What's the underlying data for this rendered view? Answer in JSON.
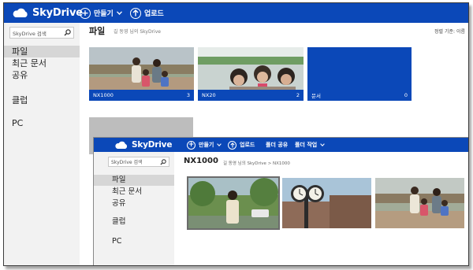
{
  "app": {
    "title": "SkyDrive"
  },
  "toolbar": {
    "create_label": "만들기",
    "upload_label": "업로드"
  },
  "sidebar": {
    "search_placeholder": "SkyDrive 검색",
    "items": [
      {
        "label": "파일",
        "selected": true
      },
      {
        "label": "최근 문서",
        "selected": false
      },
      {
        "label": "공유",
        "selected": false
      },
      {
        "label": "클럽",
        "selected": false
      },
      {
        "label": "PC",
        "selected": false
      }
    ]
  },
  "main": {
    "title": "파일",
    "breadcrumb": "길 동영 님의 SkyDrive",
    "sort_label": "정렬 기준: 이름",
    "tiles": [
      {
        "name": "NX1000",
        "count": "3"
      },
      {
        "name": "NX20",
        "count": "2"
      },
      {
        "name": "문서",
        "count": "0"
      }
    ]
  },
  "overlay": {
    "app_title": "SkyDrive",
    "toolbar": {
      "create_label": "만들기",
      "upload_label": "업로드",
      "share_folder_label": "폴더 공유",
      "folder_actions_label": "폴더 작업"
    },
    "sidebar": {
      "search_placeholder": "SkyDrive 검색",
      "items": [
        {
          "label": "파일",
          "selected": true
        },
        {
          "label": "최근 문서",
          "selected": false
        },
        {
          "label": "공유",
          "selected": false
        },
        {
          "label": "클럽",
          "selected": false
        },
        {
          "label": "PC",
          "selected": false
        }
      ]
    },
    "title": "NX1000",
    "breadcrumb": "길 동영 님의 SkyDrive > NX1000"
  },
  "colors": {
    "accent": "#0b48b8",
    "sidebar_bg": "#f2f2f2",
    "selected_bg": "#d6d6d6"
  },
  "icons": [
    "skydrive-cloud-icon",
    "plus-circle-icon",
    "upload-arrow-icon",
    "chevron-down-icon",
    "search-icon"
  ]
}
